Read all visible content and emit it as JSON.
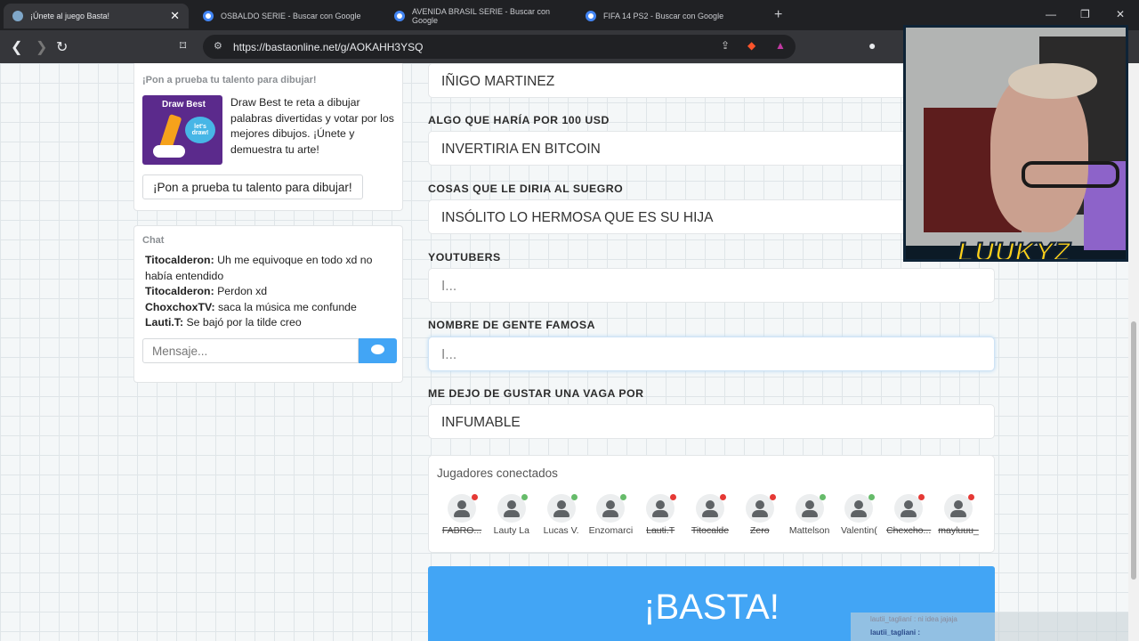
{
  "browser": {
    "tabs": [
      {
        "title": "¡Únete al juego Basta!",
        "active": true,
        "icon": "basta-favicon"
      },
      {
        "title": "OSBALDO SERIE - Buscar con Google",
        "active": false,
        "icon": "google-icon"
      },
      {
        "title": "AVENIDA BRASIL SERIE - Buscar con Google",
        "active": false,
        "icon": "google-icon"
      },
      {
        "title": "FIFA 14 PS2 - Buscar con Google",
        "active": false,
        "icon": "google-icon"
      }
    ],
    "new_tab": "+",
    "url": "https://bastaonline.net/g/AOKAHH3YSQ",
    "brave_count": "4"
  },
  "promo": {
    "title": "¡Pon a prueba tu talento para dibujar!",
    "image_title": "Draw Best",
    "image_bubble": "let's draw!",
    "text": "Draw Best te reta a dibujar palabras divertidas y votar por los mejores dibujos. ¡Únete y demuestra tu arte!",
    "button": "¡Pon a prueba tu talento para dibujar!"
  },
  "chat": {
    "title": "Chat",
    "messages": [
      {
        "user": "Titocalderon:",
        "text": " Uh me equivoque en todo xd no había entendido"
      },
      {
        "user": "Titocalderon:",
        "text": " Perdon xd"
      },
      {
        "user": "ChoxchoxTV:",
        "text": " saca la música me confunde"
      },
      {
        "user": "Lauti.T:",
        "text": " Se bajó por la tilde creo"
      }
    ],
    "input_placeholder": "Mensaje..."
  },
  "categories": [
    {
      "label": "",
      "value": "IÑIGO MARTINEZ"
    },
    {
      "label": "ALGO QUE HARÍA POR 100 USD",
      "value": "INVERTIRIA EN BITCOIN"
    },
    {
      "label": "COSAS QUE LE DIRIA AL SUEGRO",
      "value": "INSÓLITO LO HERMOSA QUE ES SU HIJA"
    },
    {
      "label": "YOUTUBERS",
      "value": "I..."
    },
    {
      "label": "NOMBRE DE GENTE FAMOSA",
      "value": "I..."
    },
    {
      "label": "ME DEJO DE GUSTAR UNA VAGA POR",
      "value": "INFUMABLE"
    }
  ],
  "players": {
    "title": "Jugadores conectados",
    "list": [
      {
        "name": "FABRO...",
        "status": "red",
        "strike": true
      },
      {
        "name": "Lauty La",
        "status": "green",
        "strike": false
      },
      {
        "name": "Lucas V.",
        "status": "green",
        "strike": false
      },
      {
        "name": "Enzomarci",
        "status": "green",
        "strike": false
      },
      {
        "name": "Lauti.T",
        "status": "red",
        "strike": true
      },
      {
        "name": "Titocalde",
        "status": "red",
        "strike": true
      },
      {
        "name": "Zero",
        "status": "red",
        "strike": true
      },
      {
        "name": "Mattelson",
        "status": "green",
        "strike": false
      },
      {
        "name": "Valentin(",
        "status": "green",
        "strike": false
      },
      {
        "name": "Chexcho...",
        "status": "red",
        "strike": true
      },
      {
        "name": "mayluuu_",
        "status": "red",
        "strike": true
      }
    ]
  },
  "basta_button": "¡BASTA!",
  "stream": {
    "cam_name": "LUUKYZ",
    "chat_line1_user": "lautii_taglianí",
    "chat_line1_text": ": ni idea jajaja",
    "chat_line2_user": "lautii_tagliani :"
  },
  "colors": {
    "accent": "#42a5f5",
    "status_green": "#66bb6a",
    "status_red": "#e53935"
  }
}
